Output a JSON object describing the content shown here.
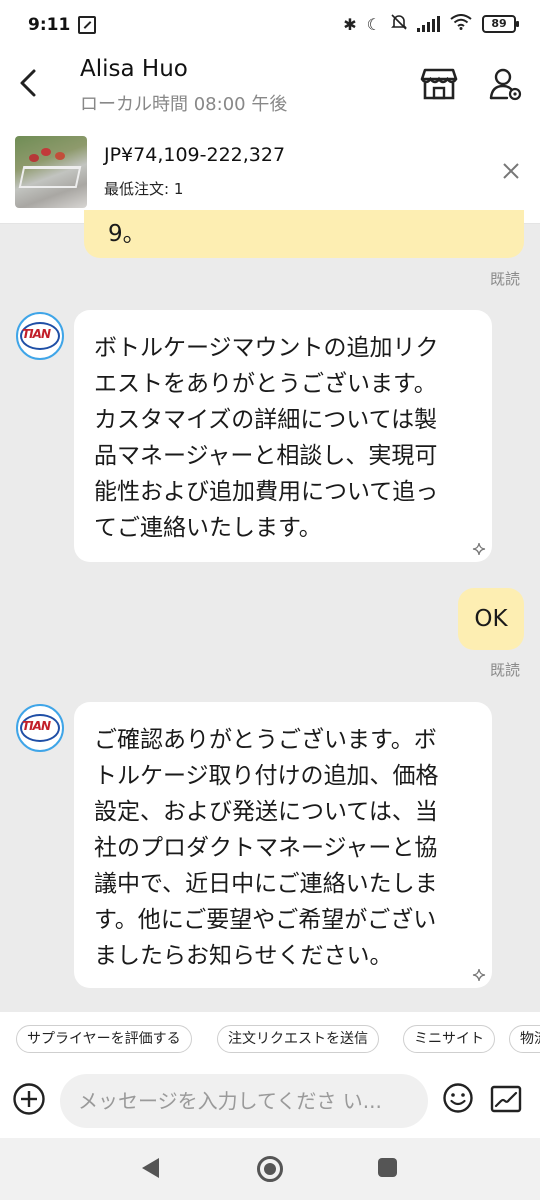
{
  "status_bar": {
    "time": "9:11",
    "battery": "89"
  },
  "header": {
    "contact_name": "Alisa Huo",
    "local_time": "ローカル時間 08:00 午後"
  },
  "product": {
    "price": "JP¥74,109-222,327",
    "min_order": "最低注文: 1"
  },
  "messages": [
    {
      "direction": "out",
      "text": "9。",
      "status": "既読"
    },
    {
      "direction": "in",
      "lines": [
        "ボトルケージマウントの追加リク",
        "エストをありがとうございます。",
        "カスタマイズの詳細については製",
        "品マネージャーと相談し、実現可",
        "能性および追加費用について追っ",
        "てご連絡いたします。"
      ]
    },
    {
      "direction": "out",
      "text": "OK",
      "status": "既読"
    },
    {
      "direction": "in",
      "lines": [
        "ご確認ありがとうございます。ボ",
        "トルケージ取り付けの追加、価格",
        "設定、および発送については、当",
        "社のプロダクトマネージャーと協",
        "議中で、近日中にご連絡いたしま",
        "す。他にご要望やご希望がござい",
        "ましたらお知らせください。"
      ]
    }
  ],
  "quick_chips": [
    "サプライヤーを評価する",
    "注文リクエストを送信",
    "ミニサイト",
    "物流"
  ],
  "composer": {
    "placeholder": "メッセージを入力してくださ い..."
  },
  "colors": {
    "outgoing_bubble": "#fdeeb2",
    "incoming_bubble": "#ffffff",
    "chat_background": "#ebebeb"
  }
}
